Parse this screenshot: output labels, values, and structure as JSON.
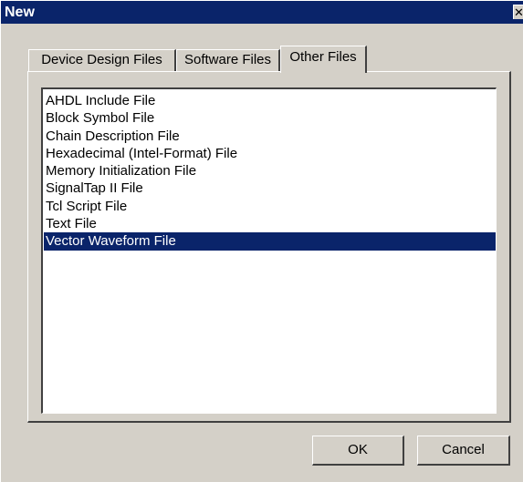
{
  "window": {
    "title": "New",
    "close_glyph": "✕"
  },
  "tabs": [
    {
      "label": "Device Design Files",
      "active": false
    },
    {
      "label": "Software Files",
      "active": false
    },
    {
      "label": "Other Files",
      "active": true
    }
  ],
  "file_list": {
    "items": [
      "AHDL Include File",
      "Block Symbol File",
      "Chain Description File",
      "Hexadecimal (Intel-Format) File",
      "Memory Initialization File",
      "SignalTap II File",
      "Tcl Script File",
      "Text File",
      "Vector Waveform File"
    ],
    "selected": "Vector Waveform File"
  },
  "buttons": {
    "ok_label": "OK",
    "cancel_label": "Cancel"
  },
  "colors": {
    "face": "#d4d0c8",
    "titlebar": "#0a246a",
    "selection": "#0a246a",
    "list_bg": "#ffffff"
  }
}
